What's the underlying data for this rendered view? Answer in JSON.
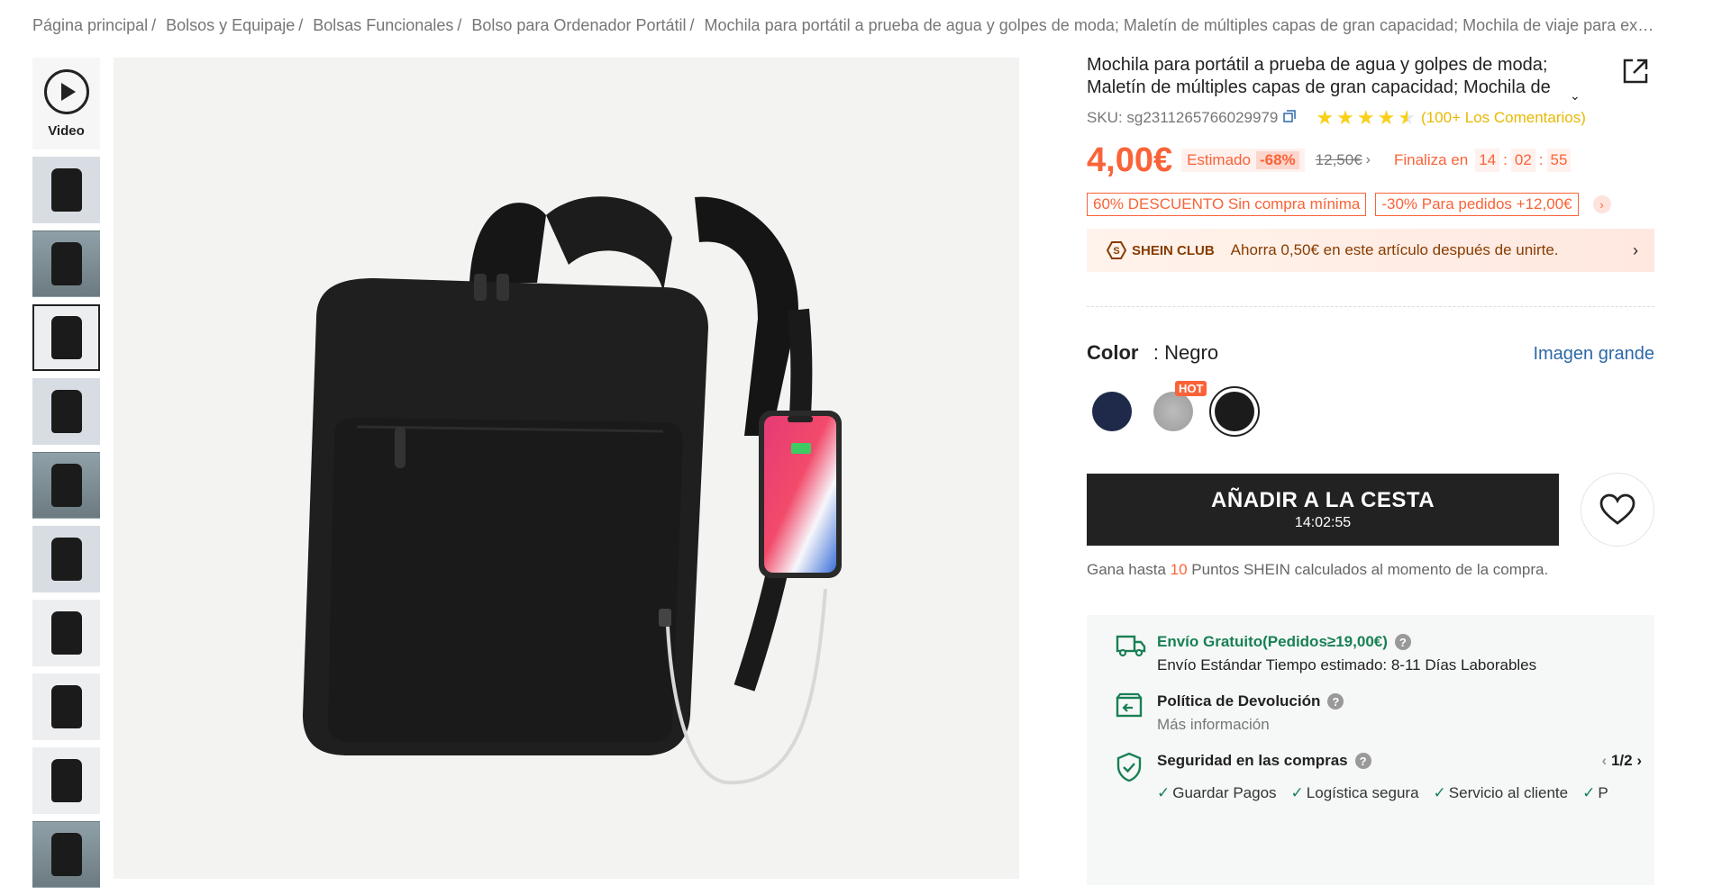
{
  "breadcrumb": [
    "Página principal",
    "Bolsos y Equipaje",
    "Bolsas Funcionales",
    "Bolso para Ordenador Portátil",
    "Mochila para portátil a prueba de agua y golpes de moda; Maletín de múltiples capas de gran capacidad; Mochila de viaje para ext…"
  ],
  "thumbs": {
    "video_label": "Video"
  },
  "product": {
    "title": "Mochila para portátil a prueba de agua y golpes de moda; Maletín de múltiples capas de gran capacidad; Mochila de viaje para exteriores",
    "sku": "SKU: sg2311265766029979",
    "rating": 4.5,
    "reviews": "(100+ Los Comentarios)",
    "price": "4,00€",
    "estimated_label": "Estimado",
    "discount_pct": "-68%",
    "original_price": "12,50€",
    "ends_label": "Finaliza en",
    "countdown": {
      "h": "14",
      "m": "02",
      "s": "55"
    },
    "promos": [
      "60% DESCUENTO Sin compra mínima",
      "-30% Para pedidos +12,00€"
    ],
    "club_brand": "SHEIN CLUB",
    "club_text": "Ahorra 0,50€ en este artículo después de unirte."
  },
  "color": {
    "label": "Color",
    "value": ": Negro",
    "big_image": "Imagen grande",
    "swatches": [
      {
        "name": "navy",
        "color": "#1f2a4a"
      },
      {
        "name": "gray",
        "color": "#a9a9a9",
        "badge": "HOT"
      },
      {
        "name": "black",
        "color": "#1b1b1b"
      }
    ]
  },
  "cart": {
    "button_label": "AÑADIR A LA CESTA",
    "countdown": "14:02:55"
  },
  "points": {
    "prefix": "Gana hasta",
    "number": "10",
    "suffix": "Puntos SHEIN calculados al momento de la compra."
  },
  "services": {
    "shipping_title": "Envío Gratuito(Pedidos≥19,00€)",
    "shipping_sub": "Envío Estándar Tiempo estimado: 8-11 Días Laborables",
    "return_title": "Política de Devolución",
    "return_sub": "Más información",
    "security_title": "Seguridad en las compras",
    "security_pager": "1/2",
    "security_items": [
      "Guardar Pagos",
      "Logística segura",
      "Servicio al cliente",
      "P"
    ]
  },
  "colors": {
    "accent": "#fa6338",
    "green": "#198055",
    "link": "#2d68a8",
    "star": "#facf19"
  }
}
